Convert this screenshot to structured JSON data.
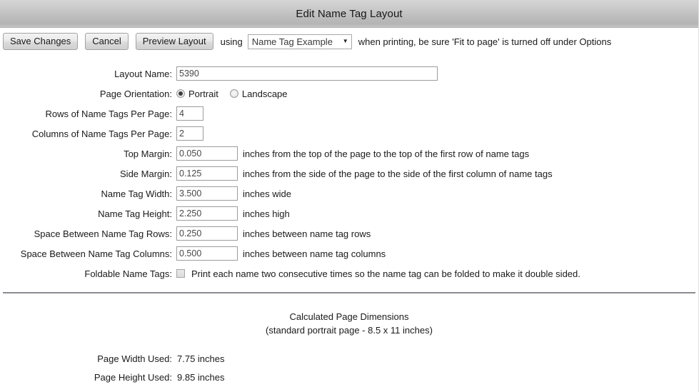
{
  "window": {
    "title": "Edit Name Tag Layout"
  },
  "toolbar": {
    "save_label": "Save Changes",
    "cancel_label": "Cancel",
    "preview_label": "Preview Layout",
    "using_label": "using",
    "preview_select": {
      "value": "Name Tag Example",
      "caret": "▼"
    },
    "note": "when printing, be sure 'Fit to page' is turned off under Options"
  },
  "form": {
    "layout_name": {
      "label": "Layout Name:",
      "value": "5390"
    },
    "page_orientation": {
      "label": "Page Orientation:",
      "options": [
        {
          "label": "Portrait",
          "selected": true
        },
        {
          "label": "Landscape",
          "selected": false
        }
      ]
    },
    "rows_per_page": {
      "label": "Rows of Name Tags Per Page:",
      "value": "4"
    },
    "columns_per_page": {
      "label": "Columns of Name Tags Per Page:",
      "value": "2"
    },
    "top_margin": {
      "label": "Top Margin:",
      "value": "0.050",
      "hint": "inches from the top of the page to the top of the first row of name tags"
    },
    "side_margin": {
      "label": "Side Margin:",
      "value": "0.125",
      "hint": "inches from the side of the page to the side of the first column of name tags"
    },
    "name_tag_width": {
      "label": "Name Tag Width:",
      "value": "3.500",
      "hint": "inches wide"
    },
    "name_tag_height": {
      "label": "Name Tag Height:",
      "value": "2.250",
      "hint": "inches high"
    },
    "space_between_rows": {
      "label": "Space Between Name Tag Rows:",
      "value": "0.250",
      "hint": "inches between name tag rows"
    },
    "space_between_columns": {
      "label": "Space Between Name Tag Columns:",
      "value": "0.500",
      "hint": "inches between name tag columns"
    },
    "foldable": {
      "label": "Foldable Name Tags:",
      "checked": false,
      "hint": "Print each name two consecutive times so the name tag can be folded to make it double sided."
    }
  },
  "calculated": {
    "heading": "Calculated Page Dimensions",
    "subheading": "(standard portrait page - 8.5 x 11 inches)",
    "page_width_used": {
      "label": "Page Width Used:",
      "value": "7.75 inches"
    },
    "page_height_used": {
      "label": "Page Height Used:",
      "value": "9.85 inches"
    }
  }
}
